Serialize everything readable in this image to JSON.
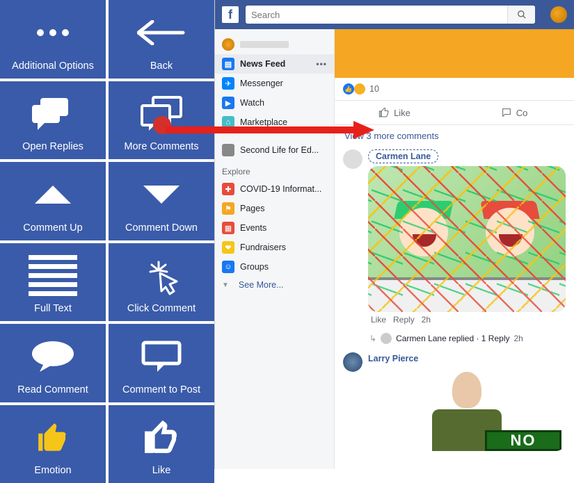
{
  "grid": [
    {
      "label": "Additional Options",
      "icon": "dots-icon"
    },
    {
      "label": "Back",
      "icon": "back-arrow-icon"
    },
    {
      "label": "Open Replies",
      "icon": "replies-icon"
    },
    {
      "label": "More Comments",
      "icon": "more-comments-icon",
      "highlight": true
    },
    {
      "label": "Comment Up",
      "icon": "triangle-up-icon"
    },
    {
      "label": "Comment Down",
      "icon": "triangle-down-icon"
    },
    {
      "label": "Full Text",
      "icon": "lines-icon"
    },
    {
      "label": "Click Comment",
      "icon": "click-cursor-icon"
    },
    {
      "label": "Read Comment",
      "icon": "speech-bubble-icon"
    },
    {
      "label": "Comment to Post",
      "icon": "comment-box-icon"
    },
    {
      "label": "Emotion",
      "icon": "thumb-filled-icon"
    },
    {
      "label": "Like",
      "icon": "thumb-outline-icon"
    }
  ],
  "topbar": {
    "search_placeholder": "Search"
  },
  "sidebar": {
    "items": [
      {
        "label": "News Feed",
        "active": true,
        "dots": "•••"
      },
      {
        "label": "Messenger"
      },
      {
        "label": "Watch"
      },
      {
        "label": "Marketplace"
      }
    ],
    "shortcut": {
      "label": "Second Life for Ed..."
    },
    "explore_header": "Explore",
    "explore": [
      {
        "label": "COVID-19 Informat..."
      },
      {
        "label": "Pages"
      },
      {
        "label": "Events"
      },
      {
        "label": "Fundraisers"
      },
      {
        "label": "Groups"
      }
    ],
    "see_more": "See More..."
  },
  "post": {
    "reaction_count": "10",
    "like_label": "Like",
    "comment_label_trunc": "Co",
    "view_more": "View 3 more comments",
    "comment1": {
      "author": "Carmen Lane",
      "like": "Like",
      "reply": "Reply",
      "time": "2h",
      "reply_line": "Carmen Lane replied · 1 Reply",
      "reply_time": "2h"
    },
    "comment2": {
      "author": "Larry Pierce",
      "sign_text": "NO"
    }
  }
}
